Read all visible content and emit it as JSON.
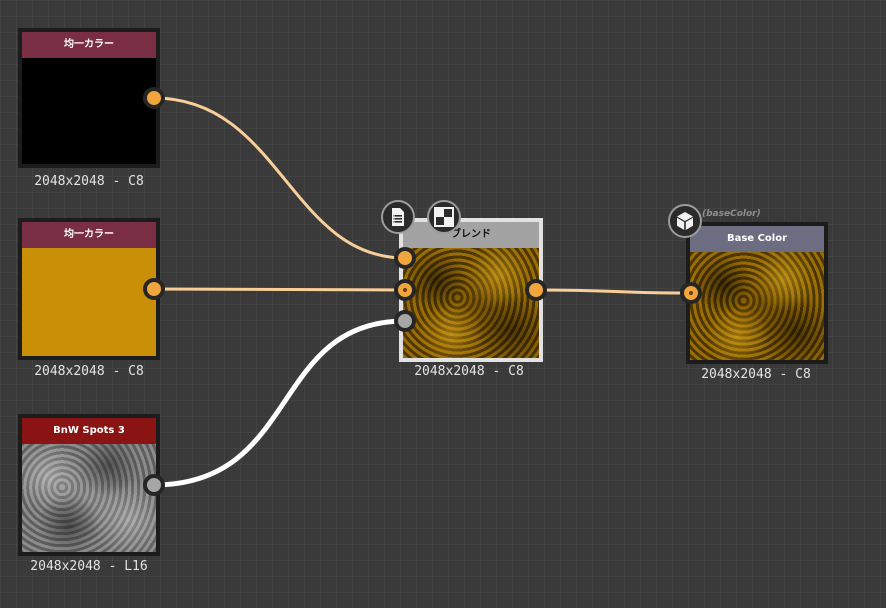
{
  "graph": {
    "nodes": {
      "uniform_black": {
        "title": "均一カラー",
        "label": "2048x2048 - C8",
        "header_color": "#7a2e43",
        "preview": "solid-black"
      },
      "uniform_orange": {
        "title": "均一カラー",
        "label": "2048x2048 - C8",
        "header_color": "#7a2e43",
        "preview": "solid-orange"
      },
      "bnw_spots": {
        "title": "BnW Spots 3",
        "label": "2048x2048 - L16",
        "header_color": "#8a1414",
        "preview": "grayscale-noise"
      },
      "blend": {
        "title": "ブレンド",
        "label": "2048x2048 - C8",
        "header_color": "#a3a3a3",
        "preview": "gold-noise",
        "icons": [
          "document-list-icon",
          "checker-icon"
        ]
      },
      "base_color": {
        "title": "Base Color",
        "label": "2048x2048 - C8",
        "header_color": "#6d6d82",
        "tag": "(baseColor)",
        "preview": "gold-noise",
        "icons": [
          "cube-icon"
        ]
      }
    },
    "colors": {
      "port_color": "#f0a63d",
      "port_gray": "#a6a6a6",
      "wire_color": "#f8cf98",
      "wire_gray": "#ffffff",
      "background": "#3a3a3a"
    }
  }
}
